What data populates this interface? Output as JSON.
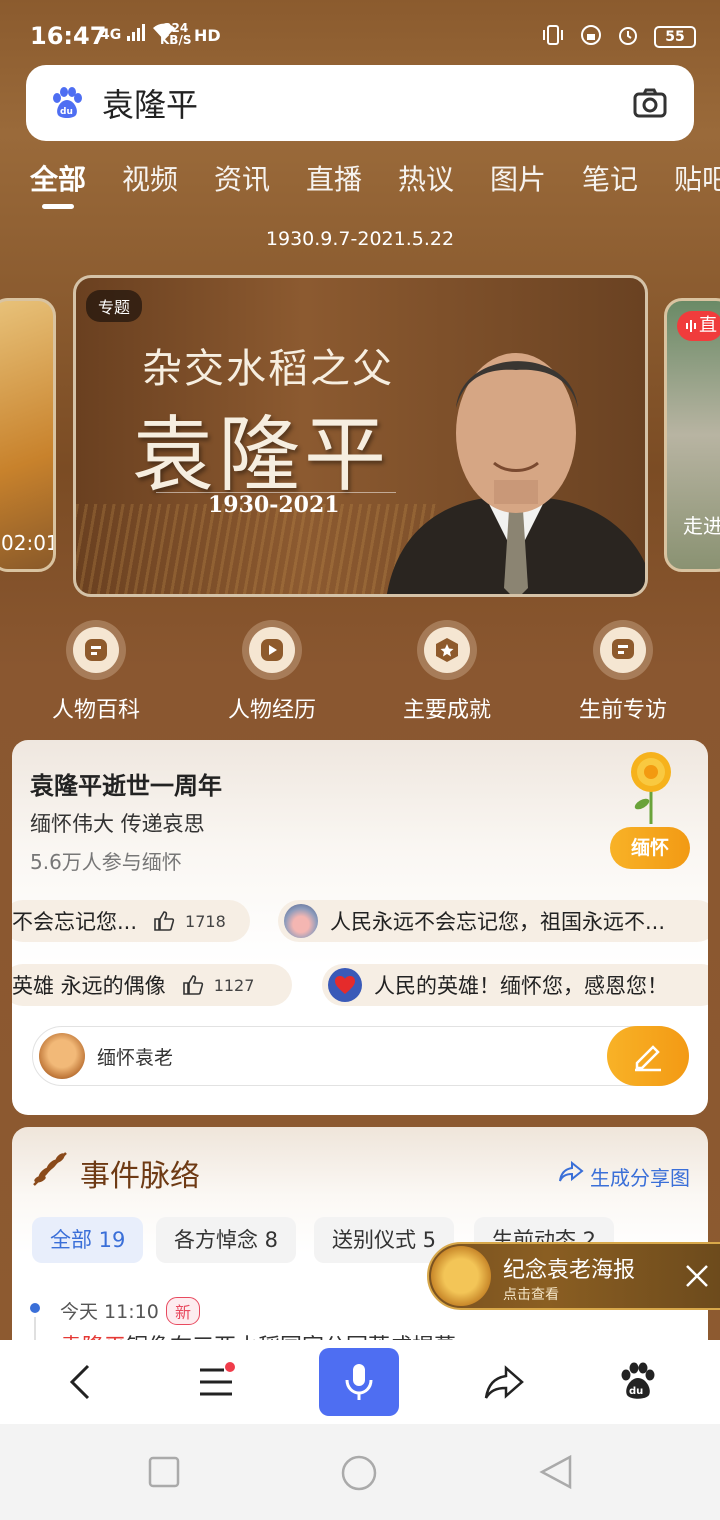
{
  "status_bar": {
    "time": "16:47",
    "network": "4G",
    "speed_value": "324",
    "speed_unit": "KB/S",
    "hd": "HD",
    "battery": "55"
  },
  "search": {
    "query": "袁隆平",
    "brand_color": "#4e6ef2"
  },
  "tabs": [
    {
      "label": "全部",
      "active": true
    },
    {
      "label": "视频"
    },
    {
      "label": "资讯"
    },
    {
      "label": "直播"
    },
    {
      "label": "热议"
    },
    {
      "label": "图片"
    },
    {
      "label": "笔记"
    },
    {
      "label": "贴吧"
    }
  ],
  "header": {
    "date_range": "1930.9.7-2021.5.22"
  },
  "carousel": {
    "left_caption": "02:01",
    "right_caption": "走进",
    "right_badge": "直",
    "main": {
      "tag": "专题",
      "subtitle": "杂交水稻之父",
      "title": "袁隆平",
      "years": "1930-2021"
    }
  },
  "quick_links": [
    {
      "label": "人物百科",
      "icon": "encyclopedia-icon"
    },
    {
      "label": "人物经历",
      "icon": "play-icon"
    },
    {
      "label": "主要成就",
      "icon": "star-icon"
    },
    {
      "label": "生前专访",
      "icon": "interview-icon"
    }
  ],
  "memorial": {
    "title": "袁隆平逝世一周年",
    "subtitle": "缅怀伟大 传递哀思",
    "participants": "5.6万人参与缅怀",
    "button": "缅怀",
    "accent": "#f5a81e",
    "bullets_row1": [
      {
        "text": "不会忘记您...",
        "likes": "1718"
      },
      {
        "text": "人民永远不会忘记您，祖国永远不..."
      }
    ],
    "bullets_row2": [
      {
        "text": "英雄 永远的偶像",
        "likes": "1127"
      },
      {
        "text": "人民的英雄！缅怀您，感恩您！"
      }
    ],
    "comment_placeholder": "缅怀袁老"
  },
  "events": {
    "title": "事件脉络",
    "share": "生成分享图",
    "chips": [
      {
        "label": "全部 19",
        "active": true
      },
      {
        "label": "各方悼念 8"
      },
      {
        "label": "送别仪式 5"
      },
      {
        "label": "生前动态 2"
      }
    ],
    "timeline": {
      "time": "今天 11:10",
      "badge": "新",
      "text_highlight": "袁隆平",
      "text_rest": "铜像在三亚水稻国家公园落成揭幕"
    }
  },
  "poster": {
    "title": "纪念袁老海报",
    "subtitle": "点击查看"
  }
}
